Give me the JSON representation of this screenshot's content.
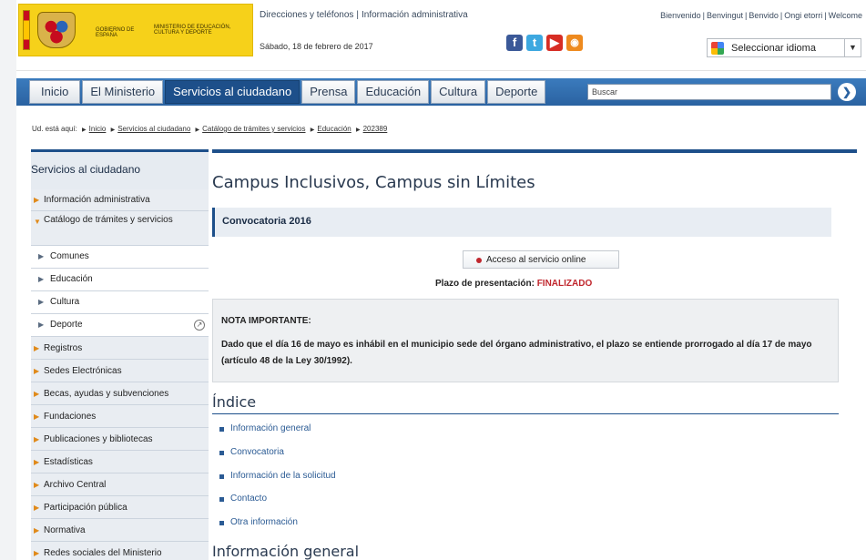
{
  "header": {
    "gov_text_1": "GOBIERNO DE ESPAÑA",
    "gov_text_2": "MINISTERIO DE EDUCACIÓN, CULTURA Y DEPORTE",
    "top_links": [
      "Direcciones y teléfonos",
      "Información administrativa"
    ],
    "lang_links": [
      "Bienvenido",
      "Benvingut",
      "Benvido",
      "Ongi etorri",
      "Welcome"
    ],
    "date": "Sábado, 18 de febrero de 2017",
    "social": {
      "facebook": "f",
      "twitter": "t",
      "youtube": "▶",
      "rss": "◉"
    },
    "language_select": "Seleccionar idioma",
    "language_arrow": "▼"
  },
  "nav": {
    "tabs": [
      "Inicio",
      "El Ministerio",
      "Servicios al ciudadano",
      "Prensa",
      "Educación",
      "Cultura",
      "Deporte"
    ],
    "active_index": 2,
    "search_placeholder": "Buscar",
    "search_go": "❯"
  },
  "breadcrumb": {
    "prefix": "Ud. está aquí:",
    "items": [
      "Inicio",
      "Servicios al ciudadano",
      "Catálogo de trámites y servicios",
      "Educación",
      "202389"
    ]
  },
  "sidebar": {
    "title": "Servicios al ciudadano",
    "items": [
      "Información administrativa",
      "Catálogo de trámites y servicios",
      "Comunes",
      "Educación",
      "Cultura",
      "Deporte",
      "Registros",
      "Sedes Electrónicas",
      "Becas, ayudas y subvenciones",
      "Fundaciones",
      "Publicaciones y bibliotecas",
      "Estadísticas",
      "Archivo Central",
      "Participación pública",
      "Normativa",
      "Redes sociales del Ministerio"
    ]
  },
  "main": {
    "title": "Campus Inclusivos, Campus sin Límites",
    "convocatoria": "Convocatoria 2016",
    "online_button": "Acceso al servicio online",
    "plazo_label": "Plazo de presentación:",
    "plazo_status": "FINALIZADO",
    "notice_title": "NOTA IMPORTANTE:",
    "notice_body": "Dado que el día 16 de mayo es inhábil en el municipio sede del órgano administrativo, el plazo se entiende prorrogado al día 17 de mayo (artículo 48 de la Ley 30/1992).",
    "index_title": "Índice",
    "index_items": [
      "Información general",
      "Convocatoria",
      "Información de la solicitud",
      "Contacto",
      "Otra información"
    ],
    "info_title": "Información general"
  },
  "colors": {
    "nav_blue": "#2a62a1",
    "active_tab": "#1d4f8a",
    "accent_orange": "#e08a1a",
    "status_red": "#c0262d",
    "logo_yellow": "#f6d11a"
  }
}
